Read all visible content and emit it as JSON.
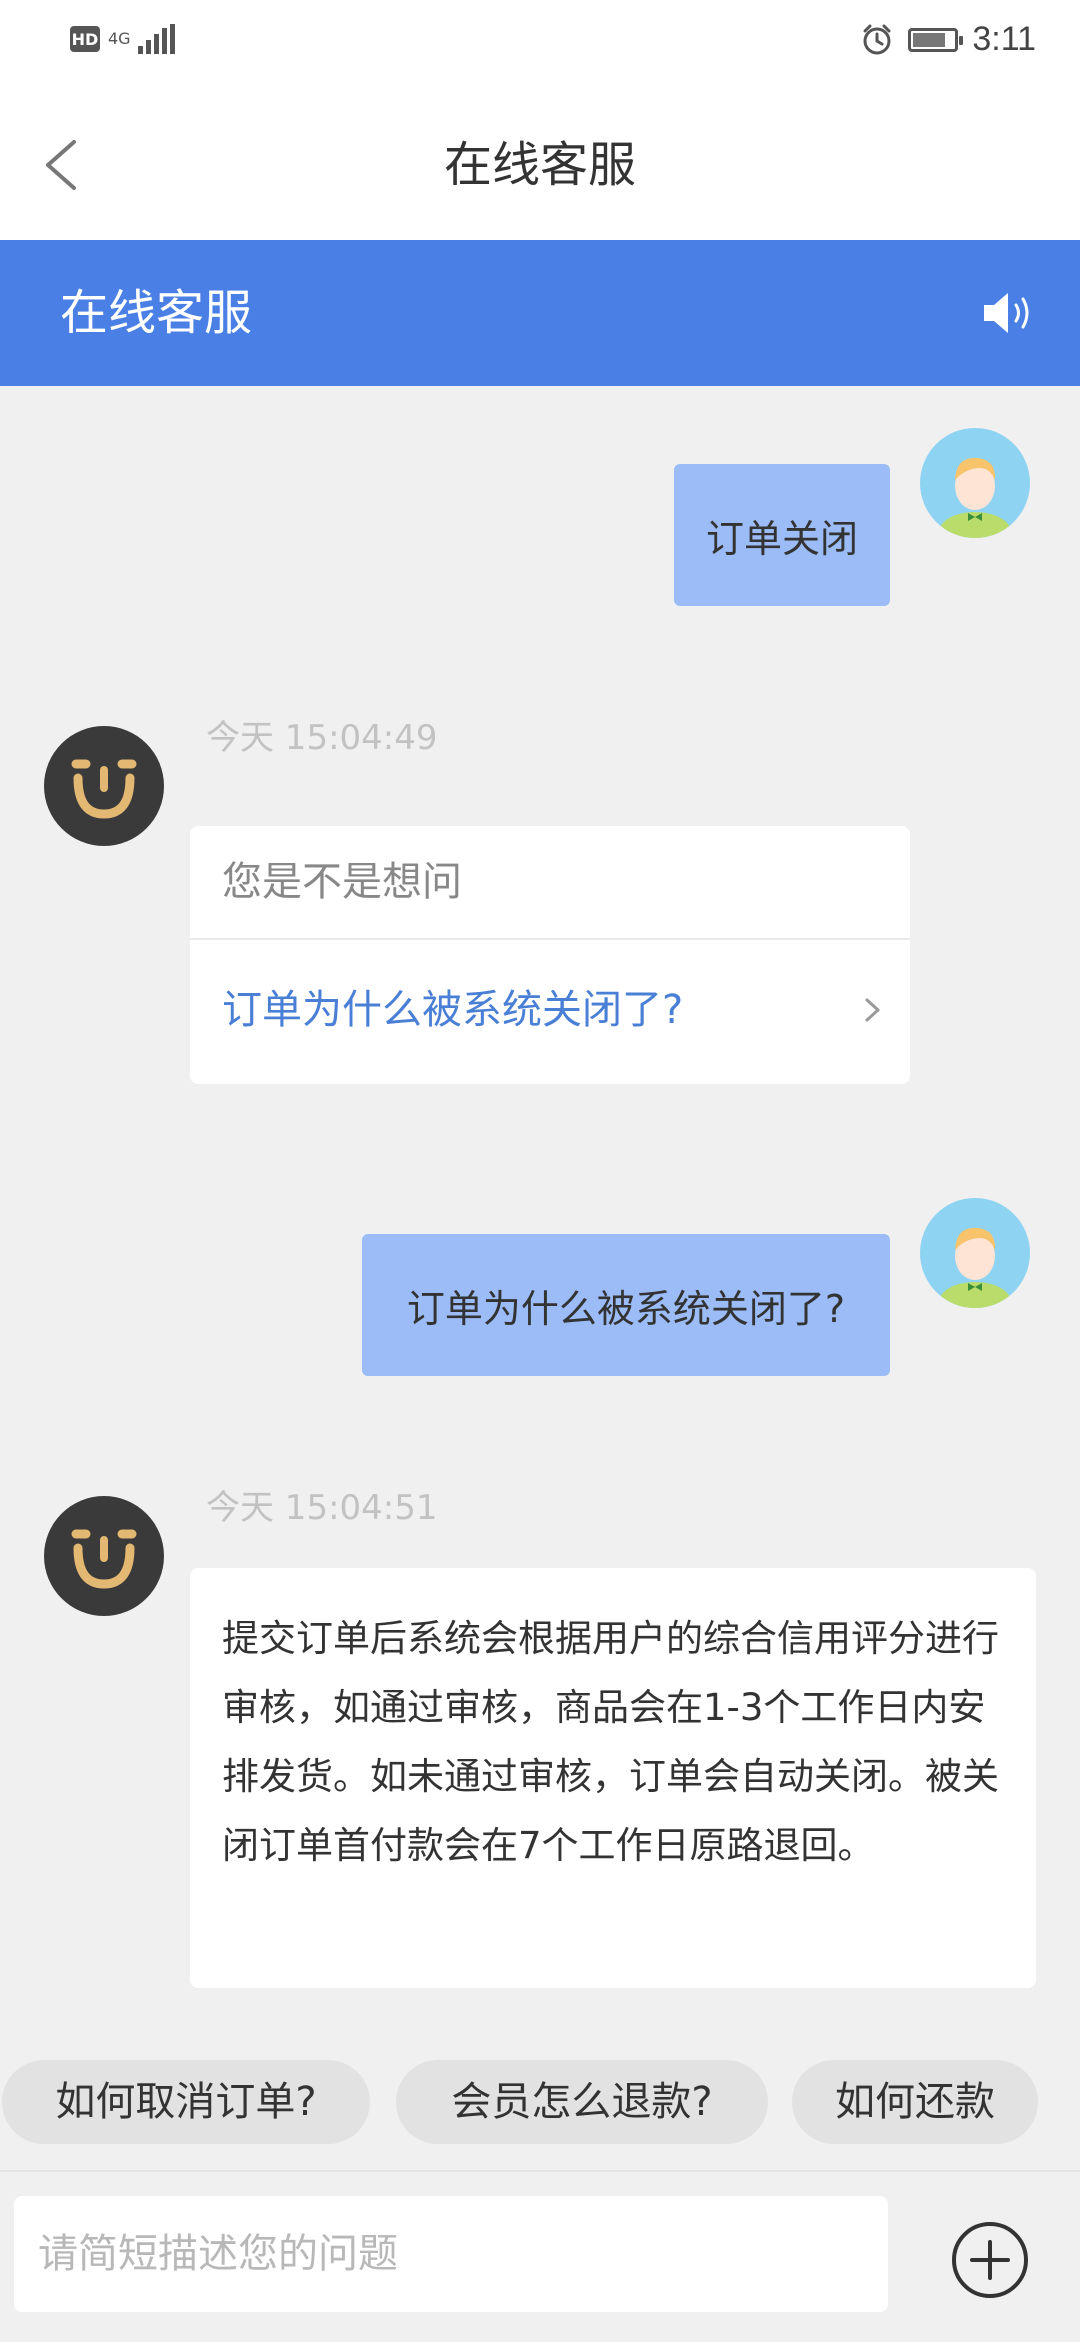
{
  "status_bar": {
    "hd": "HD",
    "network": "4G",
    "time": "3:11"
  },
  "title_bar": {
    "title": "在线客服"
  },
  "chat_header": {
    "title": "在线客服"
  },
  "messages": [
    {
      "from": "user",
      "text": "订单关闭"
    },
    {
      "from": "bot",
      "time": "今天 15:04:49",
      "prompt": "您是不是想问",
      "suggestion": "订单为什么被系统关闭了?"
    },
    {
      "from": "user",
      "text": "订单为什么被系统关闭了?"
    },
    {
      "from": "bot",
      "time": "今天 15:04:51",
      "text": "提交订单后系统会根据用户的综合信用评分进行审核，如通过审核，商品会在1-3个工作日内安排发货。如未通过审核，订单会自动关闭。被关闭订单首付款会在7个工作日原路退回。"
    }
  ],
  "quick_replies": [
    "如何取消订单?",
    "会员怎么退款?",
    "如何还款"
  ],
  "input": {
    "placeholder": "请简短描述您的问题",
    "value": ""
  },
  "colors": {
    "header_blue": "#4a80e6",
    "user_bubble": "#9bbcf7",
    "link_blue": "#4a7fd6",
    "bot_logo_gold": "#e3b873"
  },
  "icons": [
    "back-arrow-icon",
    "speaker-icon",
    "chevron-right-icon",
    "plus-circle-icon",
    "alarm-icon",
    "battery-icon",
    "signal-icon"
  ]
}
